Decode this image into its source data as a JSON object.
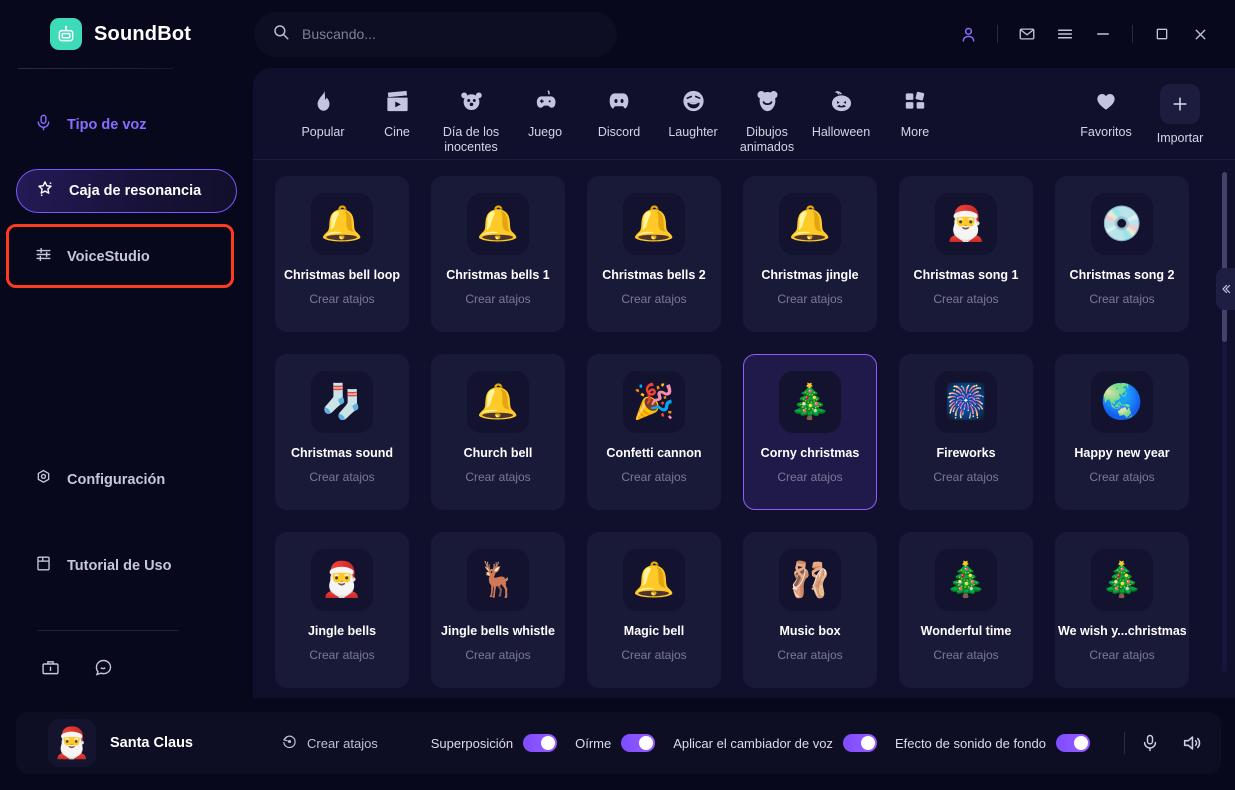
{
  "app": {
    "name": "SoundBot",
    "logo_color": "#3ddbb8"
  },
  "search": {
    "value": "",
    "placeholder": "Buscando...",
    "icon": "search-icon"
  },
  "titlebar": {
    "account_icon": "user-icon",
    "mail_icon": "mail-icon",
    "menu_icon": "hamburger-menu-icon",
    "minimize_icon": "minimize-icon",
    "maximize_icon": "maximize-icon",
    "close_icon": "close-icon",
    "accent": "#8a6bff"
  },
  "sidebar": {
    "items": [
      {
        "label": "Tipo de voz",
        "icon": "microphone-icon",
        "state": "accent"
      },
      {
        "label": "Caja de resonancia",
        "icon": "magic-wand-icon",
        "state": "active"
      },
      {
        "label": "VoiceStudio",
        "icon": "sliders-icon",
        "state": "normal"
      }
    ],
    "bottom_items": [
      {
        "label": "Configuración",
        "icon": "gear-icon"
      },
      {
        "label": "Tutorial de Uso",
        "icon": "book-icon"
      }
    ],
    "footer_icons": [
      {
        "icon": "toolbox-icon"
      },
      {
        "icon": "chat-bubble-icon"
      }
    ],
    "highlight_color": "#ff3b1f"
  },
  "categories": [
    {
      "label": "Popular",
      "icon": "flame-icon",
      "glyph": "🔥"
    },
    {
      "label": "Cine",
      "icon": "clapperboard-icon",
      "glyph": "🎬"
    },
    {
      "label": "Día de los inocentes",
      "icon": "clown-icon",
      "glyph": "🤡"
    },
    {
      "label": "Juego",
      "icon": "gamepad-icon",
      "glyph": "🎮"
    },
    {
      "label": "Discord",
      "icon": "discord-icon",
      "glyph": "●"
    },
    {
      "label": "Laughter",
      "icon": "laughing-face-icon",
      "glyph": "😆"
    },
    {
      "label": "Dibujos animados",
      "icon": "bear-face-icon",
      "glyph": "🐻"
    },
    {
      "label": "Halloween",
      "icon": "pumpkin-icon",
      "glyph": "🎃"
    },
    {
      "label": "More",
      "icon": "grid-more-icon",
      "glyph": "■"
    }
  ],
  "category_actions": [
    {
      "label": "Favoritos",
      "icon": "heart-icon",
      "glyph": "♥"
    },
    {
      "label": "Importar",
      "icon": "plus-icon",
      "glyph": "+"
    }
  ],
  "sounds": [
    {
      "title": "Christmas bell loop",
      "subtitle": "Crear atajos",
      "icon": "christmas-bells-icon",
      "glyph": "🔔",
      "selected": false
    },
    {
      "title": "Christmas bells 1",
      "subtitle": "Crear atajos",
      "icon": "christmas-bells-icon",
      "glyph": "🔔",
      "selected": false
    },
    {
      "title": "Christmas bells 2",
      "subtitle": "Crear atajos",
      "icon": "red-bell-icon",
      "glyph": "🔔",
      "selected": false
    },
    {
      "title": "Christmas jingle",
      "subtitle": "Crear atajos",
      "icon": "jingle-bell-icon",
      "glyph": "🔔",
      "selected": false
    },
    {
      "title": "Christmas song 1",
      "subtitle": "Crear atajos",
      "icon": "santa-face-icon",
      "glyph": "🎅",
      "selected": false
    },
    {
      "title": "Christmas song 2",
      "subtitle": "Crear atajos",
      "icon": "music-record-icon",
      "glyph": "💿",
      "selected": false
    },
    {
      "title": "Christmas sound",
      "subtitle": "Crear atajos",
      "icon": "stocking-icon",
      "glyph": "🧦",
      "selected": false
    },
    {
      "title": "Church bell",
      "subtitle": "Crear atajos",
      "icon": "church-bell-icon",
      "glyph": "🔔",
      "selected": false
    },
    {
      "title": "Confetti cannon",
      "subtitle": "Crear atajos",
      "icon": "party-popper-icon",
      "glyph": "🎉",
      "selected": false
    },
    {
      "title": "Corny christmas",
      "subtitle": "Crear atajos",
      "icon": "christmas-tree-icon",
      "glyph": "🎄",
      "selected": true
    },
    {
      "title": "Fireworks",
      "subtitle": "Crear atajos",
      "icon": "fireworks-icon",
      "glyph": "🎆",
      "selected": false
    },
    {
      "title": "Happy new year",
      "subtitle": "Crear atajos",
      "icon": "happy-new-year-icon",
      "glyph": "🌏",
      "selected": false
    },
    {
      "title": "Jingle bells",
      "subtitle": "Crear atajos",
      "icon": "santa-wreath-icon",
      "glyph": "🎅",
      "selected": false
    },
    {
      "title": "Jingle bells whistle",
      "subtitle": "Crear atajos",
      "icon": "reindeer-icon",
      "glyph": "🦌",
      "selected": false
    },
    {
      "title": "Magic bell",
      "subtitle": "Crear atajos",
      "icon": "hand-bell-icon",
      "glyph": "🔔",
      "selected": false
    },
    {
      "title": "Music box",
      "subtitle": "Crear atajos",
      "icon": "ballerina-music-box-icon",
      "glyph": "🩰",
      "selected": false
    },
    {
      "title": "Wonderful time",
      "subtitle": "Crear atajos",
      "icon": "christmas-tree-gifts-icon",
      "glyph": "🎄",
      "selected": false
    },
    {
      "title": "We wish y...christmas",
      "subtitle": "Crear atajos",
      "icon": "christmas-tree-gifts-icon",
      "glyph": "🎄",
      "selected": false
    }
  ],
  "content_panel": {
    "collapse_icon": "double-chevron-left-icon",
    "scrollbar": "vertical-scrollbar"
  },
  "bottombar": {
    "voice_name": "Santa Claus",
    "avatar_icon": "santa-avatar",
    "shortcut_label": "Crear atajos",
    "shortcut_icon": "rotate-shortcut-icon",
    "toggles": [
      {
        "label": "Superposición",
        "on": true
      },
      {
        "label": "Oírme",
        "on": true
      },
      {
        "label": "Aplicar el cambiador de voz",
        "on": true
      },
      {
        "label": "Efecto de sonido de fondo",
        "on": true
      }
    ],
    "mic_icon": "microphone-icon",
    "speaker_icon": "speaker-icon",
    "toggle_on_color": "#8a5bff"
  }
}
